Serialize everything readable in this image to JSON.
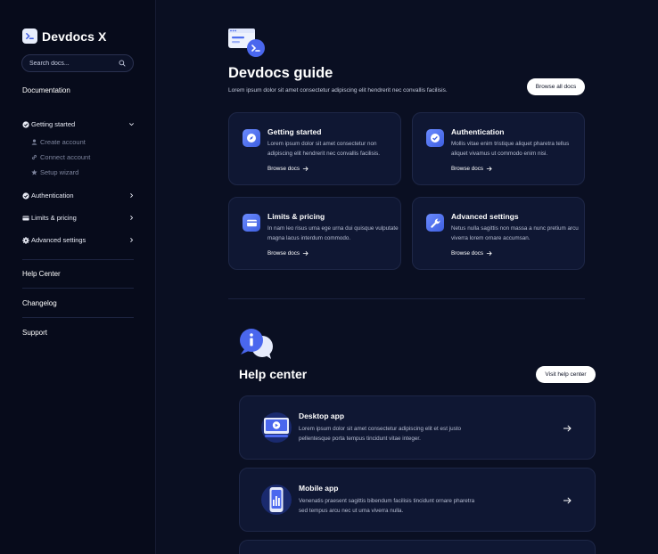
{
  "sidebar": {
    "brand": "Devdocs X",
    "search_placeholder": "Search docs...",
    "section_documentation": "Documentation",
    "getting_started": "Getting started",
    "sub_items": [
      "Create account",
      "Connect account",
      "Setup wizard"
    ],
    "authentication": "Authentication",
    "limits_pricing": "Limits & pricing",
    "advanced_settings": "Advanced settings",
    "help_center": "Help Center",
    "changelog": "Changelog",
    "support": "Support"
  },
  "guide": {
    "title": "Devdocs guide",
    "subtitle": "Lorem ipsum dolor sit amet consectetur adipiscing elit hendrerit nec convallis facilisis.",
    "browse_all": "Browse all docs",
    "cards": [
      {
        "title": "Getting started",
        "desc": "Lorem ipsum dolor sit amet consectetur non adipiscing elit hendrerit nec convallis facilisis.",
        "link": "Browse docs",
        "icon": "compass-icon"
      },
      {
        "title": "Authentication",
        "desc": "Mollis vitae enim tristique aliquet pharetra tellus aliquet vivamus ut commodo enim nisi.",
        "link": "Browse docs",
        "icon": "check-shield-icon"
      },
      {
        "title": "Limits & pricing",
        "desc": "In nam leo risus urna ege urna dui quisque vulputate magna lacus interdum commodo.",
        "link": "Browse docs",
        "icon": "credit-card-icon"
      },
      {
        "title": "Advanced settings",
        "desc": "Netus nulla sagittis non massa a nunc pretium arcu viverra lorem ornare accumsan.",
        "link": "Browse docs",
        "icon": "wrench-icon"
      }
    ]
  },
  "help": {
    "title": "Help center",
    "visit": "Visit help center",
    "cards": [
      {
        "title": "Desktop app",
        "desc": "Lorem ipsum dolor sit amet consectetur adipiscing elit et est justo pellentesque porta tempus tincidunt vitae integer.",
        "icon": "desktop-icon"
      },
      {
        "title": "Mobile app",
        "desc": "Venenatis praesent sagittis bibendum facilisis tincidunt ornare pharetra sed tempus arcu nec ut urna viverra nulla.",
        "icon": "mobile-icon"
      }
    ]
  },
  "colors": {
    "background": "#0a0f22",
    "sidebar": "#070b1b",
    "card": "#0f1733",
    "accent": "#4f6ff0"
  }
}
